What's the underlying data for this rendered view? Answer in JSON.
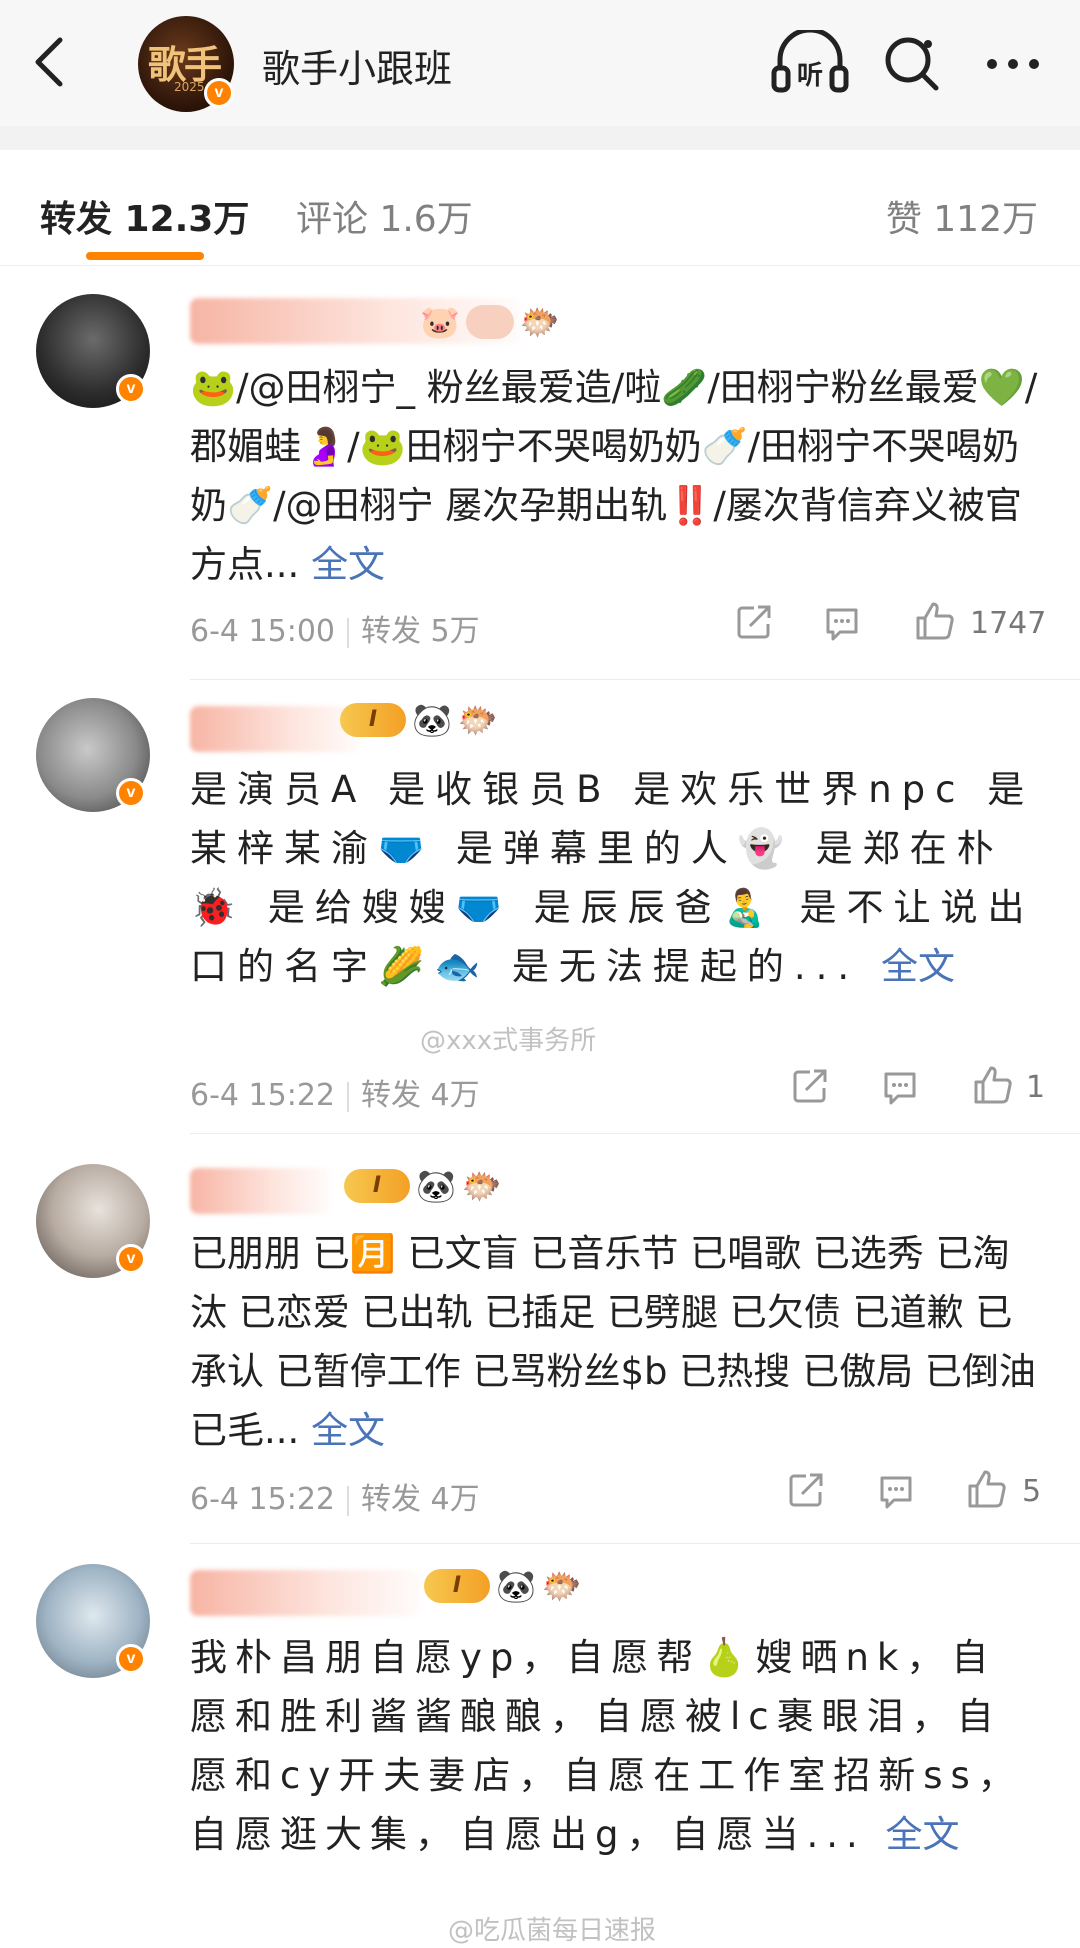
{
  "header": {
    "title": "歌手小跟班",
    "avatar_logo": "歌手",
    "avatar_year": "2025",
    "verified_mark": "v",
    "icons": [
      "back-icon",
      "listen-icon",
      "search-icon",
      "more-icon"
    ],
    "listen_label": "听"
  },
  "tabs": {
    "repost": "转发 12.3万",
    "comment": "评论 1.6万",
    "like": "赞 112万"
  },
  "colors": {
    "accent": "#ff8200",
    "link": "#4a73b8",
    "meta": "#999999"
  },
  "posts": [
    {
      "badges": [
        "🐷",
        "🐡"
      ],
      "text": "🐸/@田栩宁_ 粉丝最爱造/啦🥒/田栩宁粉丝最爱💚/郡媚蛙🤰/🐸田栩宁不哭喝奶奶🍼/田栩宁不哭喝奶奶🍼/@田栩宁 屡次孕期出轨‼️/屡次背信弃义被官方点...",
      "more": "全文",
      "time": "6-4 15:00",
      "reposts": "转发 5万",
      "likes": "1747"
    },
    {
      "badges": [
        "I",
        "🐼",
        "🐡"
      ],
      "text": "是演员A 是收银员B 是欢乐世界npc 是某梓某渝🩲 是弹幕里的人👻 是郑在朴🐞 是给嫂嫂🩲 是辰辰爸👨‍🍼 是不让说出口的名字🌽🐟 是无法提起的...",
      "more": "全文",
      "time": "6-4 15:22",
      "reposts": "转发 4万",
      "likes": "1"
    },
    {
      "badges": [
        "I",
        "🐼",
        "🐡"
      ],
      "text": "已朋朋 已🈷️ 已文盲 已音乐节 已唱歌 已选秀 已淘汰 已恋爱 已出轨 已插足 已劈腿 已欠债 已道歉 已承认 已暂停工作 已骂粉丝$b 已热搜 已傲局 已倒油 已毛...",
      "more": "全文",
      "time": "6-4 15:22",
      "reposts": "转发 4万",
      "likes": "5"
    },
    {
      "badges": [
        "I",
        "🐼",
        "🐡"
      ],
      "text": "我朴昌朋自愿yp，自愿帮🍐嫂晒nk，自愿和胜利酱酱酿酿，自愿被lc裹眼泪，自愿和cy开夫妻店，自愿在工作室招新ss，自愿逛大集，自愿出g，自愿当...",
      "more": "全文",
      "time": "",
      "reposts": "",
      "likes": ""
    }
  ],
  "watermarks": [
    "@xxx式事务所",
    "@吃瓜菌每日速报"
  ]
}
